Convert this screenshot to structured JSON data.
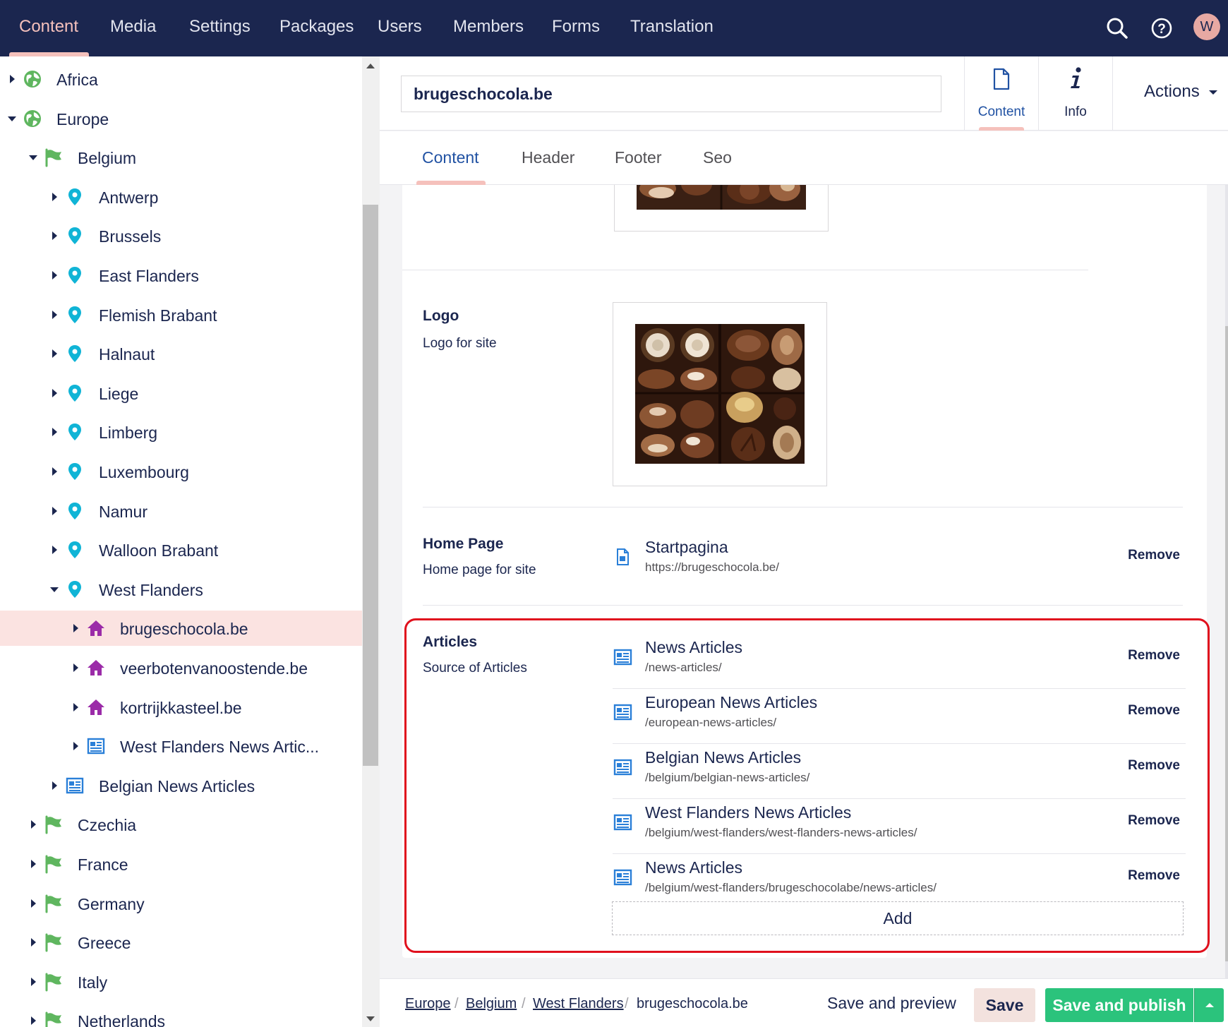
{
  "topnav": {
    "items": [
      "Content",
      "Media",
      "Settings",
      "Packages",
      "Users",
      "Members",
      "Forms",
      "Translation"
    ],
    "active": "Content",
    "user_initial": "W"
  },
  "tree": {
    "items": [
      {
        "label": "Africa",
        "icon": "globe-icon",
        "expanded": false
      },
      {
        "label": "Europe",
        "icon": "globe-icon",
        "expanded": true
      },
      {
        "label": "Belgium",
        "icon": "flag-icon",
        "expanded": true
      },
      {
        "label": "Antwerp",
        "icon": "map-pin-icon",
        "expanded": false
      },
      {
        "label": "Brussels",
        "icon": "map-pin-icon",
        "expanded": false
      },
      {
        "label": "East Flanders",
        "icon": "map-pin-icon",
        "expanded": false
      },
      {
        "label": "Flemish Brabant",
        "icon": "map-pin-icon",
        "expanded": false
      },
      {
        "label": "Halnaut",
        "icon": "map-pin-icon",
        "expanded": false
      },
      {
        "label": "Liege",
        "icon": "map-pin-icon",
        "expanded": false
      },
      {
        "label": "Limberg",
        "icon": "map-pin-icon",
        "expanded": false
      },
      {
        "label": "Luxembourg",
        "icon": "map-pin-icon",
        "expanded": false
      },
      {
        "label": "Namur",
        "icon": "map-pin-icon",
        "expanded": false
      },
      {
        "label": "Walloon Brabant",
        "icon": "map-pin-icon",
        "expanded": false
      },
      {
        "label": "West Flanders",
        "icon": "map-pin-icon",
        "expanded": true
      },
      {
        "label": "brugeschocola.be",
        "icon": "home-icon",
        "expanded": false,
        "selected": true
      },
      {
        "label": "veerbotenvanoostende.be",
        "icon": "home-icon",
        "expanded": false
      },
      {
        "label": "kortrijkkasteel.be",
        "icon": "home-icon",
        "expanded": false
      },
      {
        "label": "West Flanders News Artic...",
        "icon": "newspaper-icon",
        "expanded": false
      },
      {
        "label": "Belgian News Articles",
        "icon": "newspaper-icon",
        "expanded": false
      },
      {
        "label": "Czechia",
        "icon": "flag-icon",
        "expanded": false
      },
      {
        "label": "France",
        "icon": "flag-icon",
        "expanded": false
      },
      {
        "label": "Germany",
        "icon": "flag-icon",
        "expanded": false
      },
      {
        "label": "Greece",
        "icon": "flag-icon",
        "expanded": false
      },
      {
        "label": "Italy",
        "icon": "flag-icon",
        "expanded": false
      },
      {
        "label": "Netherlands",
        "icon": "flag-icon",
        "expanded": false
      }
    ]
  },
  "editor": {
    "node_name": "brugeschocola.be",
    "apps": {
      "content": "Content",
      "info": "Info"
    },
    "actions_label": "Actions",
    "tabs": [
      "Content",
      "Header",
      "Footer",
      "Seo"
    ],
    "active_tab": "Content"
  },
  "properties": {
    "logo": {
      "label": "Logo",
      "description": "Logo for site"
    },
    "home_page": {
      "label": "Home Page",
      "description": "Home page for site",
      "item": {
        "name": "Startpagina",
        "url": "https://brugeschocola.be/"
      },
      "remove": "Remove"
    },
    "articles": {
      "label": "Articles",
      "description": "Source of Articles",
      "items": [
        {
          "name": "News Articles",
          "url": "/news-articles/"
        },
        {
          "name": "European News Articles",
          "url": "/european-news-articles/"
        },
        {
          "name": "Belgian News Articles",
          "url": "/belgium/belgian-news-articles/"
        },
        {
          "name": "West Flanders News Articles",
          "url": "/belgium/west-flanders/west-flanders-news-articles/"
        },
        {
          "name": "News Articles",
          "url": "/belgium/west-flanders/brugeschocolabe/news-articles/"
        }
      ],
      "remove": "Remove",
      "add": "Add"
    }
  },
  "footer": {
    "breadcrumb": [
      "Europe",
      "Belgium",
      "West Flanders",
      "brugeschocola.be"
    ],
    "save_preview": "Save and preview",
    "save": "Save",
    "save_publish": "Save and publish"
  },
  "colors": {
    "nav_bg": "#1b264f",
    "accent_pink": "#f5c1bc",
    "selected_row": "#fbe3e1",
    "publish_green": "#2bc37c",
    "highlight_red": "#e0101d",
    "globe_green": "#5fb65f",
    "pin_cyan": "#10b4d6",
    "home_purple": "#9b2ba8",
    "doc_blue": "#2a7fd8"
  }
}
